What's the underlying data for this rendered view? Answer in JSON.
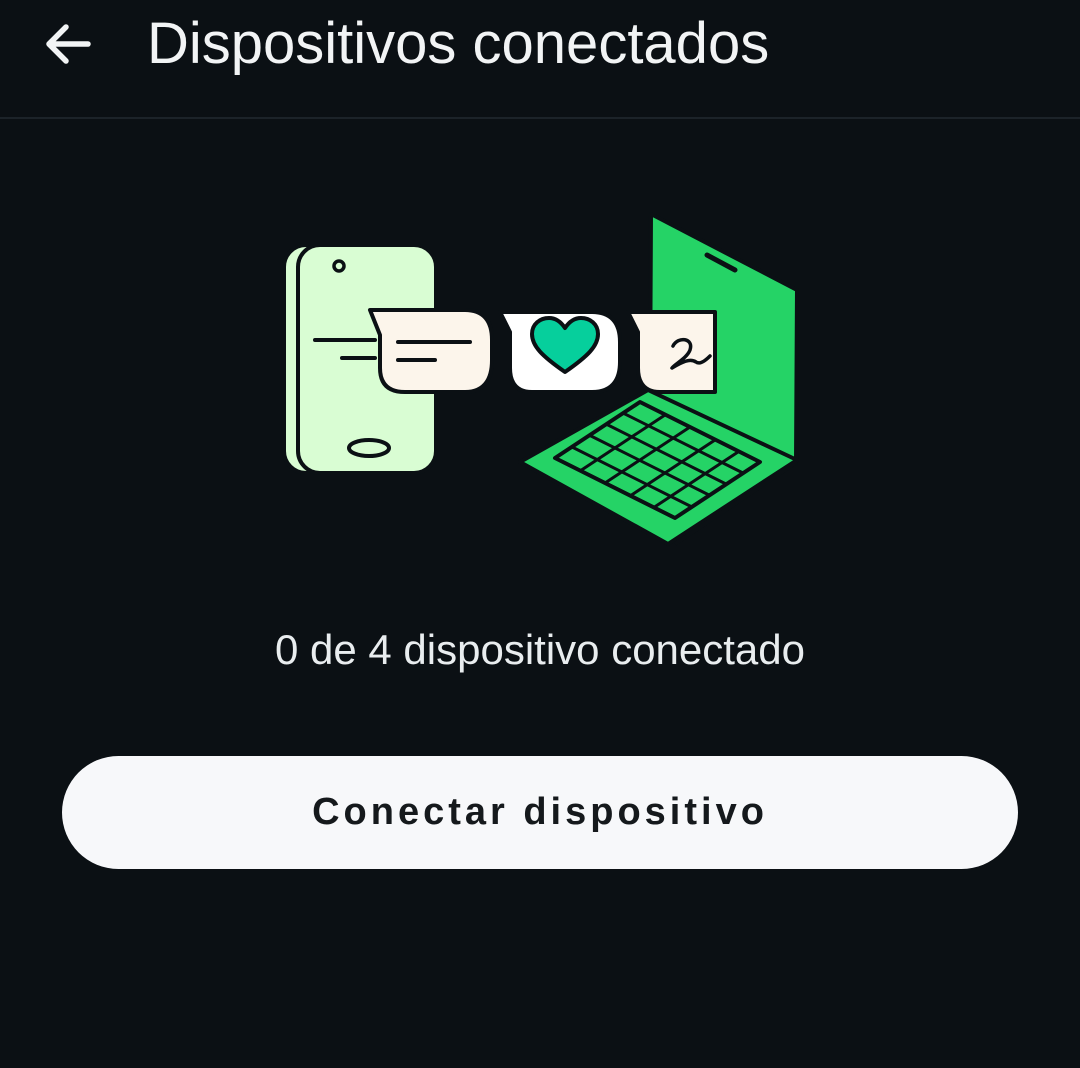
{
  "header": {
    "back_icon": "arrow-left-icon",
    "title": "Dispositivos conectados"
  },
  "illustration": {
    "icons": [
      "phone-icon",
      "message-bubble-icon",
      "heart-bubble-icon",
      "handwriting-bubble-icon",
      "laptop-icon"
    ],
    "colors": {
      "phone_fill": "#d9fdd3",
      "laptop_green": "#25d366",
      "bubble_cream": "#fcf5eb",
      "heart_teal": "#06cf9c",
      "outline": "#0b1014"
    }
  },
  "main": {
    "device_count_text": "0 de 4 dispositivo conectado",
    "connect_button_label": "Conectar dispositivo"
  },
  "theme": {
    "background": "#0b1014",
    "text": "#e9edef",
    "button_bg": "#f7f8fa"
  }
}
